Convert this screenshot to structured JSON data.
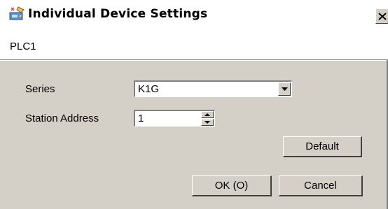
{
  "window": {
    "title": "Individual Device Settings",
    "close_label": "X"
  },
  "device": {
    "name": "PLC1"
  },
  "form": {
    "series_label": "Series",
    "series_value": "K1G",
    "station_label": "Station Address",
    "station_value": "1"
  },
  "buttons": {
    "default_label": "Default",
    "ok_label": "OK (O)",
    "cancel_label": "Cancel"
  },
  "icons": {
    "app": "device-settings-icon",
    "close": "close-icon",
    "dropdown": "chevron-down-icon",
    "spin_up": "triangle-up-icon",
    "spin_down": "triangle-down-icon"
  }
}
